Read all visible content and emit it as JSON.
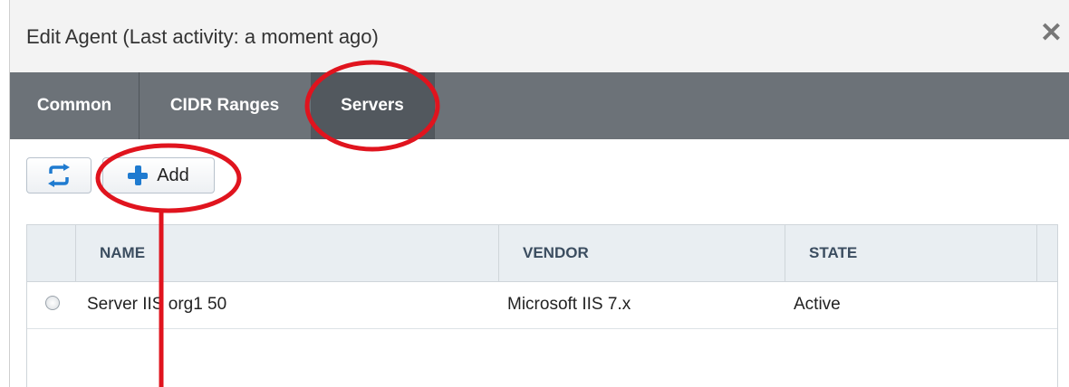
{
  "dialog": {
    "title": "Edit Agent (Last activity: a moment ago)",
    "close_symbol": "✕"
  },
  "tabs": [
    {
      "label": "Common"
    },
    {
      "label": "CIDR Ranges"
    },
    {
      "label": "Servers",
      "active": true
    }
  ],
  "toolbar": {
    "refresh_icon": "refresh-icon",
    "add_label": "Add"
  },
  "table": {
    "headers": [
      "NAME",
      "VENDOR",
      "STATE"
    ],
    "rows": [
      {
        "name": "Server IIS org1 50",
        "vendor": "Microsoft IIS 7.x",
        "state": "Active"
      }
    ]
  },
  "colors": {
    "tab_bar": "#6c7278",
    "accent_blue": "#1f7bd0",
    "annotation_red": "#e0141e"
  }
}
